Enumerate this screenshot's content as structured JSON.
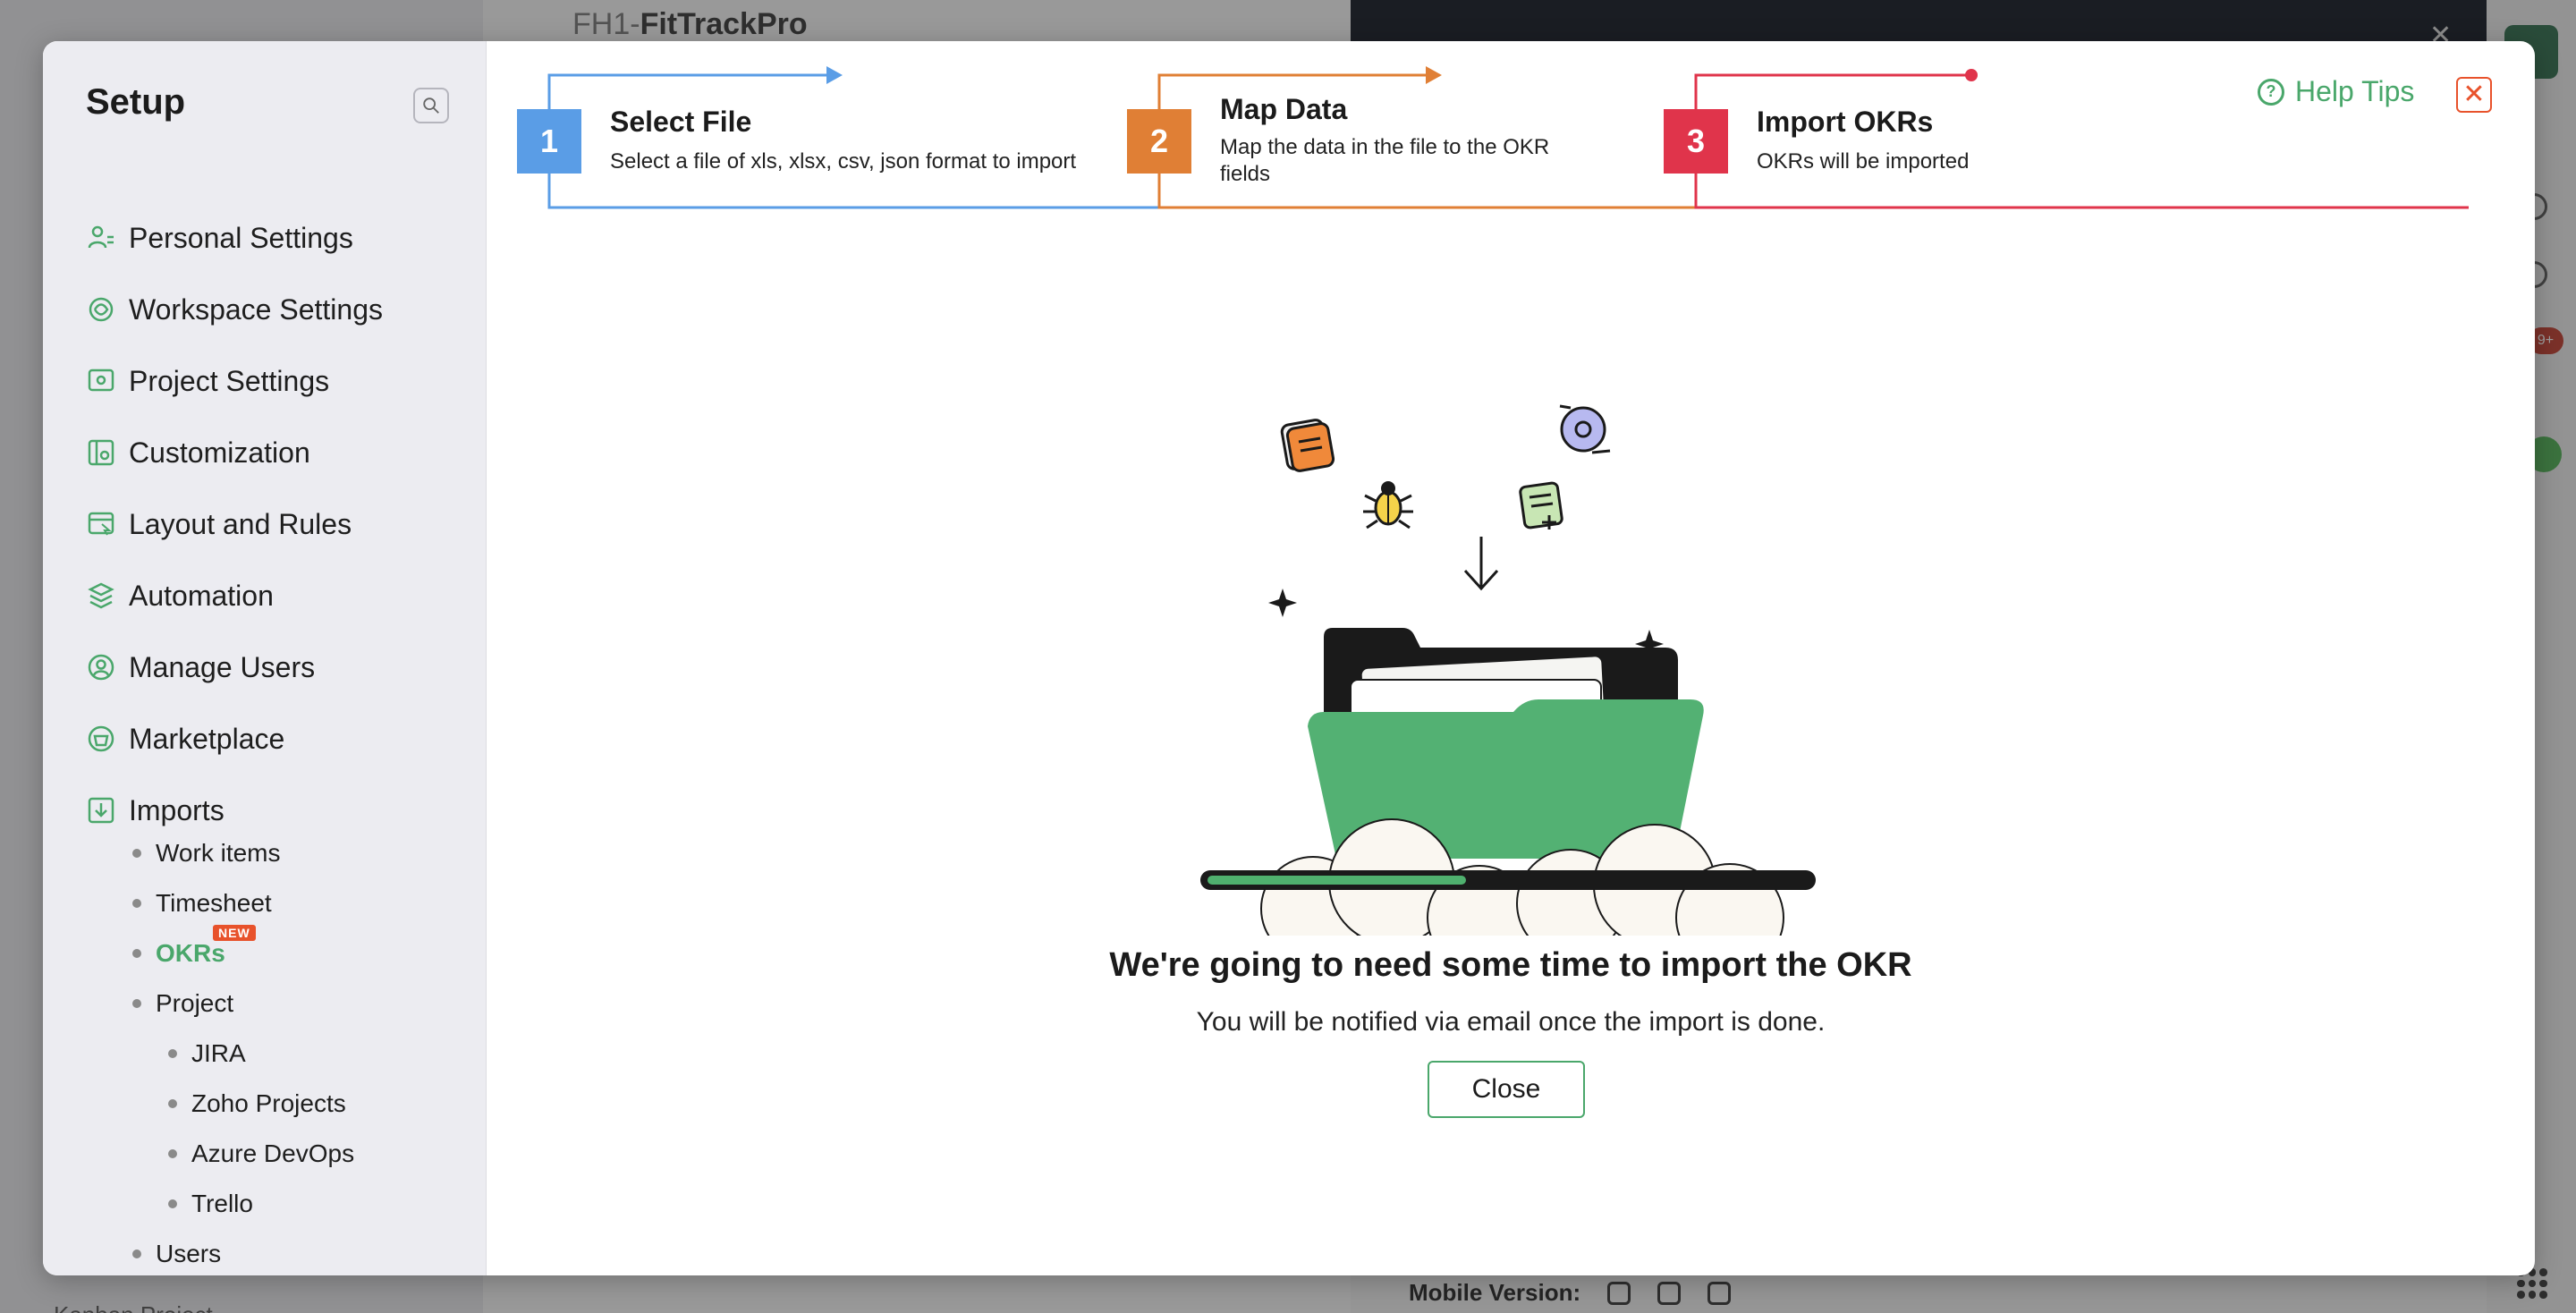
{
  "background": {
    "app_title_prefix": "FH1-",
    "app_title": "FitTrackPro",
    "notification_badge": "9+",
    "mobile_version_label": "Mobile Version:",
    "bottom_left_text": "Kanban Project"
  },
  "sidebar": {
    "title": "Setup",
    "items": [
      {
        "label": "Personal Settings",
        "icon": "person-settings-icon"
      },
      {
        "label": "Workspace Settings",
        "icon": "workspace-icon"
      },
      {
        "label": "Project Settings",
        "icon": "project-icon"
      },
      {
        "label": "Customization",
        "icon": "customization-icon"
      },
      {
        "label": "Layout and Rules",
        "icon": "layout-icon"
      },
      {
        "label": "Automation",
        "icon": "automation-icon"
      },
      {
        "label": "Manage Users",
        "icon": "users-icon"
      },
      {
        "label": "Marketplace",
        "icon": "marketplace-icon"
      },
      {
        "label": "Imports",
        "icon": "import-icon"
      }
    ],
    "sub_items": [
      {
        "label": "Work items"
      },
      {
        "label": "Timesheet"
      },
      {
        "label": "OKRs",
        "badge": "NEW"
      },
      {
        "label": "Project"
      },
      {
        "label": "JIRA"
      },
      {
        "label": "Zoho Projects"
      },
      {
        "label": "Azure DevOps"
      },
      {
        "label": "Trello"
      },
      {
        "label": "Users"
      }
    ]
  },
  "stepper": {
    "steps": [
      {
        "number": "1",
        "title": "Select File",
        "description": "Select a file of xls, xlsx, csv, json format to import",
        "color": "#5a9de6"
      },
      {
        "number": "2",
        "title": "Map Data",
        "description": "Map the data in the file to the OKR fields",
        "color": "#e07f35"
      },
      {
        "number": "3",
        "title": "Import OKRs",
        "description": "OKRs will be imported",
        "color": "#e0344b"
      }
    ]
  },
  "header": {
    "help_tips": "Help Tips",
    "close_symbol": "✕"
  },
  "main": {
    "progress": 0.43,
    "title": "We're going to need some time to import the OKR",
    "subtitle": "You will be notified via email once the import is done.",
    "close_button": "Close"
  },
  "colors": {
    "accent_green": "#4aa76b",
    "close_orange": "#e8522b"
  }
}
